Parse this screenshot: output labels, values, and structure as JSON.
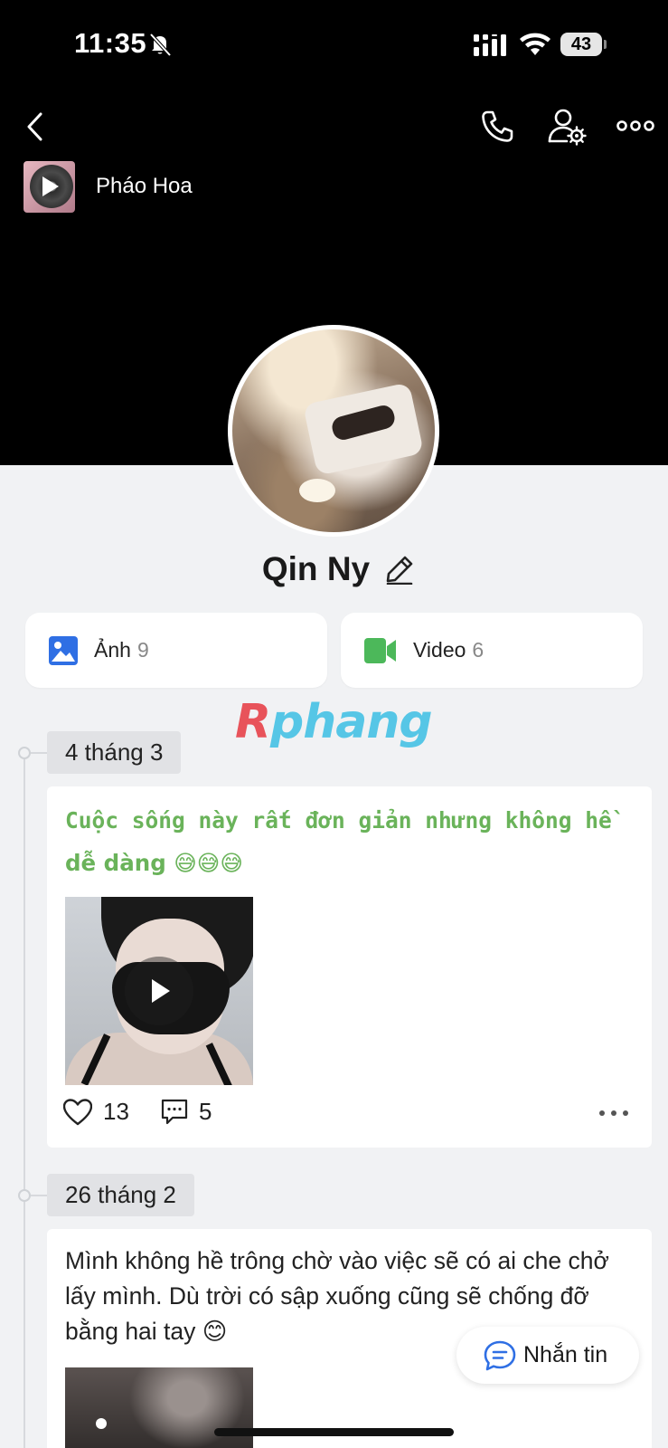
{
  "status_bar": {
    "time": "11:35",
    "battery": "43",
    "icons": [
      "bell-off-icon",
      "signal-icon",
      "wifi-icon",
      "battery-icon"
    ]
  },
  "nav": {
    "icons": [
      "back-arrow-icon",
      "phone-icon",
      "user-settings-icon",
      "more-horizontal-icon"
    ]
  },
  "music": {
    "title": "Pháo Hoa",
    "icon": "play-icon"
  },
  "profile": {
    "name": "Qin Ny",
    "edit_icon": "pencil-icon"
  },
  "media": {
    "photos_label": "Ảnh",
    "photos_count": "9",
    "photos_color": "#2f6fe4",
    "videos_label": "Video",
    "videos_count": "6",
    "videos_color": "#4cb85a"
  },
  "watermark": {
    "first": "R",
    "rest": "phang"
  },
  "timeline": [
    {
      "date": "4 tháng 3",
      "text_line1": "Cuộc sống này rất đơn giản nhưng không hề",
      "text_line2": "dễ dàng 😅😅😅",
      "text_color": "#6ab35a",
      "media": "video",
      "likes": "13",
      "comments": "5"
    },
    {
      "date": "26 tháng 2",
      "text": "Mình không hề trông chờ vào việc sẽ có ai che chở lấy mình. Dù trời có sập xuống cũng sẽ chống đỡ bằng hai tay 😊",
      "media": "photo"
    }
  ],
  "message_button": {
    "label": "Nhắn tin",
    "icon": "chat-bubble-icon"
  }
}
